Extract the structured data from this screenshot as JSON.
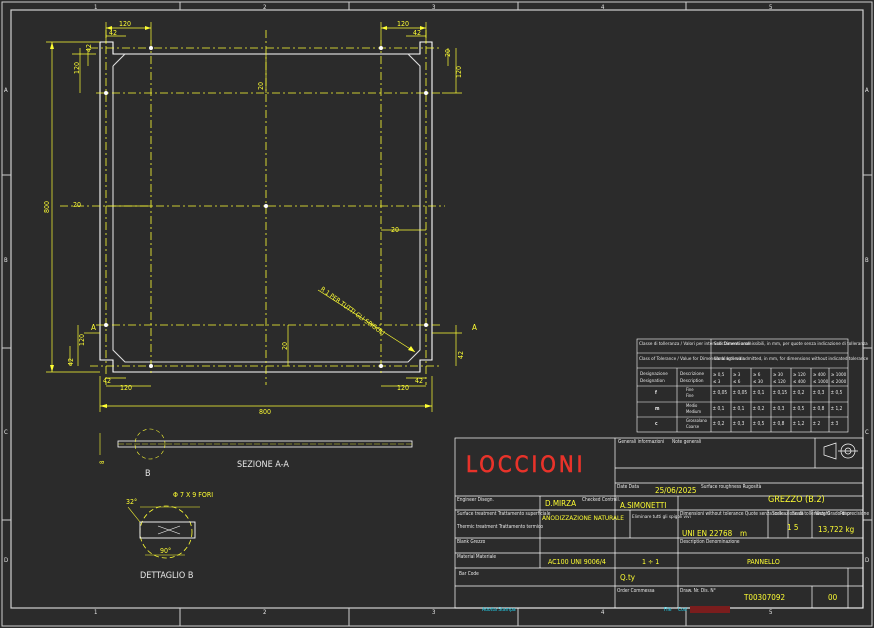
{
  "border": {
    "top_ticks": [
      "1",
      "2",
      "3",
      "4",
      "5"
    ],
    "side_ticks": [
      "A",
      "B",
      "C",
      "D"
    ],
    "bottom_ticks": [
      "1",
      "2",
      "3",
      "4",
      "5"
    ]
  },
  "drawing": {
    "dims_top": [
      "120",
      "42",
      "120",
      "42"
    ],
    "dims_small": [
      "42",
      "120",
      "20",
      "800",
      "20",
      "20",
      "20",
      "20",
      "A",
      "A",
      "42",
      "42",
      "120",
      "120",
      "800",
      "120",
      "42",
      "42",
      "120",
      "800",
      "20",
      "42"
    ],
    "radius_note": "R 1 PER TUTTI GLI SPIGOLI",
    "section_label": "SEZIONE A-A",
    "detail_label": "DETTAGLIO B",
    "detail_callout": "B",
    "hole_note": "Φ 7 X 9 FORI",
    "angle_32": "32°",
    "angle_90": "90°",
    "thickness": "8"
  },
  "tolerance_table": {
    "h1": "Classe di tolleranza / Valori per intervalli Dimensionali",
    "h1b": "Scostamenti ammissibili, in mm, per quote senza indicazione di tolleranza",
    "h2": "Class of Tolerance / Value for Dimensional Intervals",
    "h2b": "Working limit admitted, in mm, for dimensions without indicated tolerance",
    "col_label1": "Designazione",
    "col_label2": "Designation",
    "desc1": "Descrizione",
    "desc2": "Description",
    "ranges_top": [
      "0,5\n3",
      "3\n6",
      "6\n30",
      "30\n120",
      "120\n400",
      "400\n1000",
      "1000\n2000"
    ],
    "rows": [
      {
        "code": "f",
        "desc": "Fine\nFine",
        "vals": [
          "± 0,05",
          "± 0,05",
          "± 0,1",
          "± 0,15",
          "± 0,2",
          "± 0,3",
          "± 0,5"
        ]
      },
      {
        "code": "m",
        "desc": "Medio\nMedium",
        "vals": [
          "± 0,1",
          "± 0,1",
          "± 0,2",
          "± 0,3",
          "± 0,5",
          "± 0,8",
          "± 1,2"
        ]
      },
      {
        "code": "c",
        "desc": "Grossolano\nCoarse",
        "vals": [
          "± 0,2",
          "± 0,3",
          "± 0,5",
          "± 0,8",
          "± 1,2",
          "± 2",
          "± 3"
        ]
      }
    ]
  },
  "title_block": {
    "general_info": "Generali informazioni",
    "general_info2": "Note generali",
    "logo": "LOCCIONI",
    "engineer_label": "Engineer\nDisegn.",
    "engineer": "D.MIRZA",
    "checked_label": "Checked\nControll.",
    "checked": "A.SIMONETTI",
    "date_label": "Date\nData",
    "date": "25/06/2025",
    "surface_label": "Surface roughness\nRugosità",
    "roughness": "GREZZO (B.2)",
    "surface_treatment_label": "Surface treatment\nTrattamento superficiale",
    "surface_treatment": "ANODIZZAZIONE NATURALE",
    "edge_note": "Eliminare tutti gli\nspigoli vivi",
    "thermic_label": "Thermic treatment\nTrattamento termico",
    "tol_label": "Dimensioni without tolerance\nQuote senza indicazione di tolleranza\nGrado di precisione",
    "tol_std": "UNI EN 22768",
    "tol_class": "m",
    "scale_label": "Scale",
    "scale_label2": "Scala",
    "scale": "1 5",
    "weight_label": "Weight",
    "weight_label2": "Peso",
    "weight": "13,722 kg",
    "blank_label": "Blank\nGrezzo",
    "desc_label": "Description\nDenominazione",
    "material_label": "Material\nMateriale",
    "material": "AC100 UNI 9006/4",
    "qty": "1 ÷ 1",
    "description": "PANNELLO",
    "barcode_label": "Bar Code",
    "qty_label": "Q.ty",
    "order_label": "Order\nCommessa",
    "drw_label": "Draw. Nr. Dis. N°",
    "drawing_number": "T00307092",
    "revision": "00",
    "footer_left": "Adotta Stampa",
    "footer_file": "File",
    "footer_file2": "Cod"
  }
}
